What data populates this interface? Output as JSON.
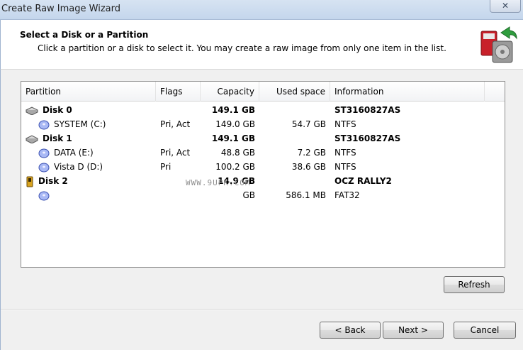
{
  "window": {
    "title": "Create Raw Image Wizard",
    "close_label": "✕"
  },
  "header": {
    "title": "Select a Disk or a Partition",
    "subtitle": "Click a partition or a disk to select it. You may create a raw image from only one item in the list."
  },
  "columns": {
    "partition": "Partition",
    "flags": "Flags",
    "capacity": "Capacity",
    "used_space": "Used space",
    "information": "Information"
  },
  "rows": [
    {
      "type": "disk",
      "icon": "hard-disk-icon",
      "partition": "Disk 0",
      "flags": "",
      "capacity": "149.1 GB",
      "used": "",
      "info": "ST3160827AS"
    },
    {
      "type": "partition",
      "icon": "partition-icon",
      "partition": "SYSTEM (C:)",
      "flags": "Pri, Act",
      "capacity": "149.0 GB",
      "used": "54.7 GB",
      "info": "NTFS"
    },
    {
      "type": "disk",
      "icon": "hard-disk-icon",
      "partition": "Disk 1",
      "flags": "",
      "capacity": "149.1 GB",
      "used": "",
      "info": "ST3160827AS"
    },
    {
      "type": "partition",
      "icon": "partition-icon",
      "partition": "DATA (E:)",
      "flags": "Pri, Act",
      "capacity": "48.8 GB",
      "used": "7.2 GB",
      "info": "NTFS"
    },
    {
      "type": "partition",
      "icon": "partition-icon",
      "partition": "Vista D (D:)",
      "flags": "Pri",
      "capacity": "100.2 GB",
      "used": "38.6 GB",
      "info": "NTFS"
    },
    {
      "type": "disk",
      "icon": "usb-drive-icon",
      "partition": "Disk 2",
      "flags": "",
      "capacity": "14.9 GB",
      "used": "",
      "info": "OCZ RALLY2"
    },
    {
      "type": "partition",
      "icon": "partition-icon",
      "partition": "",
      "flags": "",
      "capacity": "GB",
      "used": "586.1 MB",
      "info": "FAT32"
    }
  ],
  "watermark": "WWW.9UPK.COM",
  "buttons": {
    "refresh": "Refresh",
    "back": "< Back",
    "next": "Next >",
    "cancel": "Cancel"
  }
}
